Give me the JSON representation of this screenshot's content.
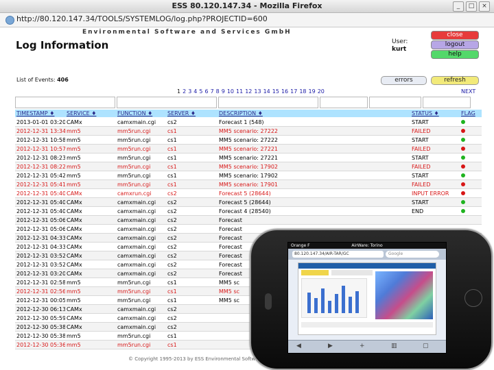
{
  "window": {
    "title": "ESS 80.120.147.34 - Mozilla Firefox"
  },
  "browser": {
    "url": "http://80.120.147.34/TOOLS/SYSTEMLOG/log.php?PROJECTID=600"
  },
  "header": {
    "company": "Environmental Software and Services GmbH",
    "title": "Log Information",
    "user_label": "User:",
    "user_name": "kurt",
    "buttons": {
      "close": "close",
      "logout": "logout",
      "help": "help"
    }
  },
  "events": {
    "label": "List of Events:",
    "count": "406"
  },
  "toolbar": {
    "errors": "errors",
    "refresh": "refresh"
  },
  "pager": {
    "pages": [
      "1",
      "2",
      "3",
      "4",
      "5",
      "6",
      "7",
      "8",
      "9",
      "10",
      "11",
      "12",
      "13",
      "14",
      "15",
      "16",
      "17",
      "18",
      "19",
      "20"
    ],
    "next": "NEXT"
  },
  "table": {
    "columns": [
      "TIMESTAMP ♦",
      "SERVICE ♦",
      "FUNCTION ♦",
      "SERVER ♦",
      "DESCRIPTION ♦",
      "STATUS ♦",
      "FLAG"
    ],
    "rows": [
      {
        "ts": "2013-01-01 03:20",
        "svc": "CAMx",
        "fn": "camxmain.cgi",
        "srv": "cs2",
        "desc": "Forecast 1 (548)",
        "status": "START",
        "flag": "#1fb31f",
        "error": false
      },
      {
        "ts": "2012-12-31 13:34",
        "svc": "mm5",
        "fn": "mm5run.cgi",
        "srv": "cs1",
        "desc": "MM5 scenario: 27222",
        "status": "FAILED",
        "flag": "#d71616",
        "error": true
      },
      {
        "ts": "2012-12-31 10:58",
        "svc": "mm5",
        "fn": "mm5run.cgi",
        "srv": "cs1",
        "desc": "MM5 scenario: 27222",
        "status": "START",
        "flag": "#1fb31f",
        "error": false
      },
      {
        "ts": "2012-12-31 10:57",
        "svc": "mm5",
        "fn": "mm5run.cgi",
        "srv": "cs1",
        "desc": "MM5 scenario: 27221",
        "status": "FAILED",
        "flag": "#d71616",
        "error": true
      },
      {
        "ts": "2012-12-31 08:23",
        "svc": "mm5",
        "fn": "mm5run.cgi",
        "srv": "cs1",
        "desc": "MM5 scenario: 27221",
        "status": "START",
        "flag": "#1fb31f",
        "error": false
      },
      {
        "ts": "2012-12-31 08:22",
        "svc": "mm5",
        "fn": "mm5run.cgi",
        "srv": "cs1",
        "desc": "MM5 scenario: 17902",
        "status": "FAILED",
        "flag": "#d71616",
        "error": true
      },
      {
        "ts": "2012-12-31 05:42",
        "svc": "mm5",
        "fn": "mm5run.cgi",
        "srv": "cs1",
        "desc": "MM5 scenario: 17902",
        "status": "START",
        "flag": "#1fb31f",
        "error": false
      },
      {
        "ts": "2012-12-31 05:41",
        "svc": "mm5",
        "fn": "mm5run.cgi",
        "srv": "cs1",
        "desc": "MM5 scenario: 17901",
        "status": "FAILED",
        "flag": "#d71616",
        "error": true
      },
      {
        "ts": "2012-12-31 05:40",
        "svc": "CAMx",
        "fn": "camxrun.cgi",
        "srv": "cs2",
        "desc": "Forecast 5 (28644)",
        "status": "INPUT ERROR",
        "flag": "#d71616",
        "error": true
      },
      {
        "ts": "2012-12-31 05:40",
        "svc": "CAMx",
        "fn": "camxmain.cgi",
        "srv": "cs2",
        "desc": "Forecast 5 (28644)",
        "status": "START",
        "flag": "#1fb31f",
        "error": false
      },
      {
        "ts": "2012-12-31 05:40",
        "svc": "CAMx",
        "fn": "camxmain.cgi",
        "srv": "cs2",
        "desc": "Forecast 4 (28540)",
        "status": "END",
        "flag": "#1fb31f",
        "error": false
      },
      {
        "ts": "2012-12-31 05:06",
        "svc": "CAMx",
        "fn": "camxmain.cgi",
        "srv": "cs2",
        "desc": "Forecast",
        "status": "",
        "flag": "",
        "error": false
      },
      {
        "ts": "2012-12-31 05:06",
        "svc": "CAMx",
        "fn": "camxmain.cgi",
        "srv": "cs2",
        "desc": "Forecast",
        "status": "",
        "flag": "",
        "error": false
      },
      {
        "ts": "2012-12-31 04:33",
        "svc": "CAMx",
        "fn": "camxmain.cgi",
        "srv": "cs2",
        "desc": "Forecast",
        "status": "",
        "flag": "",
        "error": false
      },
      {
        "ts": "2012-12-31 04:33",
        "svc": "CAMx",
        "fn": "camxmain.cgi",
        "srv": "cs2",
        "desc": "Forecast",
        "status": "",
        "flag": "",
        "error": false
      },
      {
        "ts": "2012-12-31 03:52",
        "svc": "CAMx",
        "fn": "camxmain.cgi",
        "srv": "cs2",
        "desc": "Forecast",
        "status": "",
        "flag": "",
        "error": false
      },
      {
        "ts": "2012-12-31 03:52",
        "svc": "CAMx",
        "fn": "camxmain.cgi",
        "srv": "cs2",
        "desc": "Forecast",
        "status": "",
        "flag": "",
        "error": false
      },
      {
        "ts": "2012-12-31 03:20",
        "svc": "CAMx",
        "fn": "camxmain.cgi",
        "srv": "cs2",
        "desc": "Forecast",
        "status": "",
        "flag": "",
        "error": false
      },
      {
        "ts": "2012-12-31 02:58",
        "svc": "mm5",
        "fn": "mm5run.cgi",
        "srv": "cs1",
        "desc": "MM5 sc",
        "status": "",
        "flag": "",
        "error": false
      },
      {
        "ts": "2012-12-31 02:56",
        "svc": "mm5",
        "fn": "mm5run.cgi",
        "srv": "cs1",
        "desc": "MM5 sc",
        "status": "",
        "flag": "",
        "error": true
      },
      {
        "ts": "2012-12-31 00:05",
        "svc": "mm5",
        "fn": "mm5run.cgi",
        "srv": "cs1",
        "desc": "MM5 sc",
        "status": "",
        "flag": "",
        "error": false
      },
      {
        "ts": "2012-12-30 06:13",
        "svc": "CAMx",
        "fn": "camxmain.cgi",
        "srv": "cs2",
        "desc": "",
        "status": "",
        "flag": "",
        "error": false
      },
      {
        "ts": "2012-12-30 05:59",
        "svc": "CAMx",
        "fn": "camxmain.cgi",
        "srv": "cs2",
        "desc": "",
        "status": "",
        "flag": "",
        "error": false
      },
      {
        "ts": "2012-12-30 05:38",
        "svc": "CAMx",
        "fn": "camxmain.cgi",
        "srv": "cs2",
        "desc": "",
        "status": "",
        "flag": "",
        "error": false
      },
      {
        "ts": "2012-12-30 05:38",
        "svc": "mm5",
        "fn": "mm5run.cgi",
        "srv": "cs1",
        "desc": "",
        "status": "",
        "flag": "",
        "error": false
      },
      {
        "ts": "2012-12-30 05:36",
        "svc": "mm5",
        "fn": "mm5run.cgi",
        "srv": "cs1",
        "desc": "",
        "status": "",
        "flag": "",
        "error": true
      }
    ]
  },
  "footer": {
    "copyright": "© Copyright 1995-2013 by ESS Environmental Software and Services GmbH"
  },
  "phone": {
    "status_title": "AirWare: Torino",
    "carrier": "Orange F",
    "url": "80.120.147.34/AIR-TAR/GC",
    "search_placeholder": "Google"
  }
}
